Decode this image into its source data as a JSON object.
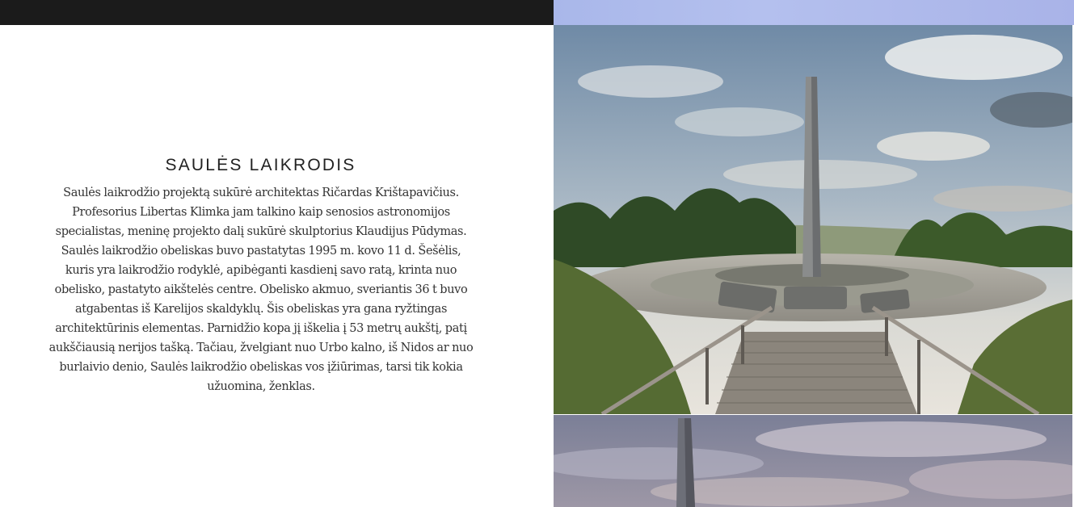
{
  "section": {
    "title": "SAULĖS LAIKRODIS",
    "paragraph": "Saulės laikrodžio projektą sukūrė architektas Ričardas Krištapavičius. Profesorius Libertas Klimka jam talkino kaip senosios astronomijos specialistas, meninę projekto dalį sukūrė skulptorius Klaudijus Pūdymas. Saulės laikrodžio obeliskas buvo pastatytas 1995 m. kovo 11 d. Šešėlis, kuris yra laikrodžio rodyklė, apibėganti kasdienį savo ratą, krinta nuo obelisko, pastatyto aikštelės centre. Obelisko akmuo, sveriantis 36 t buvo atgabentas iš Karelijos skaldyklų. Šis obeliskas yra gana ryžtingas architektūrinis elementas. Parnidžio kopa jį iškelia į 53 metrų aukštį, patį aukščiausią nerijos tašką. Tačiau, žvelgiant nuo Urbo kalno, iš Nidos ar nuo burlaivio denio, Saulės laikrodžio obeliskas vos įžiūrimas, tarsi tik kokia užuomina, ženklas."
  },
  "gallery": {
    "images": [
      {
        "alt": "sundial-obelisk-with-boardwalk-photo"
      },
      {
        "alt": "sundial-obelisk-dusk-photo"
      }
    ]
  },
  "colors": {
    "topbar": "#1b1b1b",
    "title": "#222222",
    "text": "#333333"
  }
}
